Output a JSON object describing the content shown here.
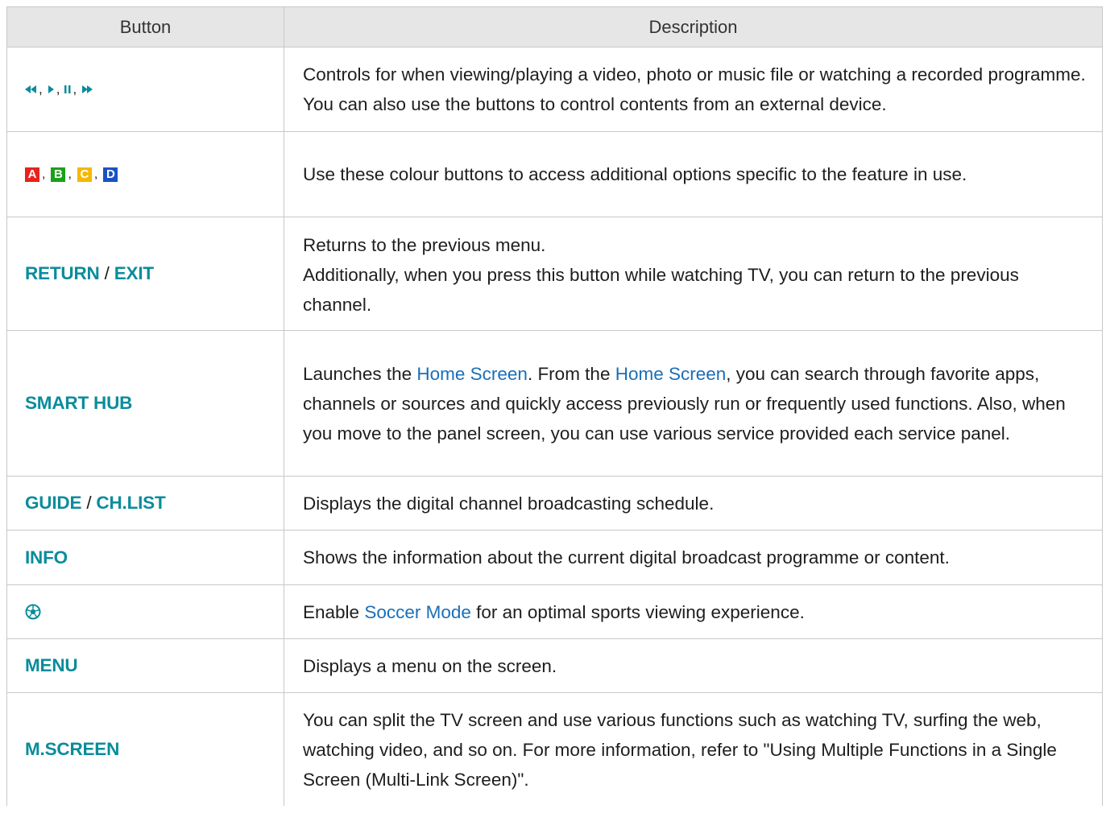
{
  "header": {
    "col_button": "Button",
    "col_description": "Description"
  },
  "rows": [
    {
      "button_icons": [
        "rewind-icon",
        "play-icon",
        "pause-icon",
        "fast-forward-icon"
      ],
      "description": "Controls for when viewing/playing a video, photo or music file or watching a recorded programme. You can also use the buttons to control contents from an external device."
    },
    {
      "color_keys": [
        {
          "letter": "A",
          "color": "#e8221d"
        },
        {
          "letter": "B",
          "color": "#1aa01a"
        },
        {
          "letter": "C",
          "color": "#f5b800"
        },
        {
          "letter": "D",
          "color": "#1853c6"
        }
      ],
      "description": "Use these colour buttons to access additional options specific to the feature in use."
    },
    {
      "button": {
        "a": "RETURN",
        "sep": " / ",
        "b": "EXIT"
      },
      "description_line1": "Returns to the previous menu.",
      "description_line2": "Additionally, when you press this button while watching TV, you can return to the previous channel."
    },
    {
      "button": "SMART HUB",
      "description": {
        "p1": "Launches the ",
        "k1": "Home Screen",
        "p2": ". From the ",
        "k2": "Home Screen",
        "p3": ", you can search through favorite apps, channels or sources and quickly access previously run or frequently used functions. Also, when you move to the panel screen, you can use various service provided each service panel."
      }
    },
    {
      "button": {
        "a": "GUIDE",
        "sep": " / ",
        "b": "CH.LIST"
      },
      "description": "Displays the digital channel broadcasting schedule."
    },
    {
      "button": "INFO",
      "description": "Shows the information about the current digital broadcast programme or content."
    },
    {
      "button_icon": "soccer-ball-icon",
      "description": {
        "p1": "Enable ",
        "k1": "Soccer Mode",
        "p2": " for an optimal sports viewing experience."
      }
    },
    {
      "button": "MENU",
      "description": "Displays a menu on the screen."
    },
    {
      "button": "M.SCREEN",
      "description": "You can split the TV screen and use various functions such as watching TV, surfing the web, watching video, and so on. For more information, refer to \"Using Multiple Functions in a Single Screen (Multi-Link Screen)\"."
    }
  ],
  "colors": {
    "button_text": "#0a8c9c",
    "keyword_text": "#1a6fb7",
    "header_bg": "#e6e6e6",
    "border": "#c8c8c8"
  }
}
